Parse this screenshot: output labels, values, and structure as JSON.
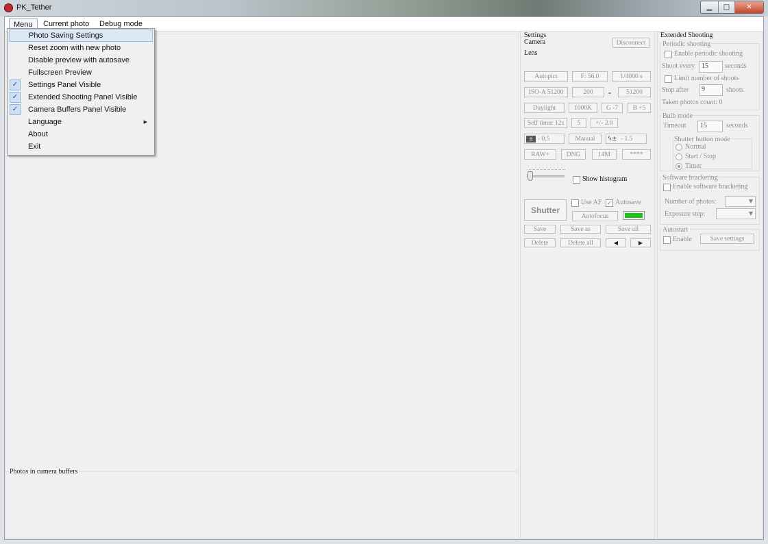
{
  "window": {
    "title": "PK_Tether"
  },
  "menubar": {
    "menu": "Menu",
    "current_photo": "Current photo",
    "debug_mode": "Debug mode"
  },
  "dropdown": {
    "items": [
      {
        "label": "Photo Saving Settings",
        "checked": false,
        "highlighted": true
      },
      {
        "label": "Reset zoom with new photo",
        "checked": false
      },
      {
        "label": "Disable preview with autosave",
        "checked": false
      },
      {
        "label": "Fullscreen Preview",
        "checked": false
      },
      {
        "label": "Settings Panel Visible",
        "checked": true
      },
      {
        "label": "Extended Shooting Panel Visible",
        "checked": true
      },
      {
        "label": "Camera Buffers Panel Visible",
        "checked": true
      },
      {
        "label": "Language",
        "has_submenu": true
      },
      {
        "label": "About"
      },
      {
        "label": "Exit"
      }
    ]
  },
  "buffers": {
    "title": "Photos in camera buffers"
  },
  "settings": {
    "title": "Settings",
    "camera_label": "Camera",
    "lens_label": "Lens",
    "disconnect": "Disconnect",
    "mode": "Autopict",
    "aperture": "F: 56.0",
    "shutter_speed": "1/4000 s",
    "iso_auto": "ISO-A 51200",
    "iso_min": "200",
    "iso_dash": "-",
    "iso_max": "51200",
    "wb": "Daylight",
    "wb_kelvin": "1000K",
    "wb_g": "G -7",
    "wb_b": "B +5",
    "self_timer": "Self timer 12s",
    "timer_count": "5",
    "exp_comp_range": "+/- 2.0",
    "exp_comp": "- 0,5",
    "flash_mode": "Manual",
    "flash_comp": "- 1.5",
    "format": "RAW+",
    "raw_format": "DNG",
    "resolution": "14M",
    "quality": "****",
    "show_histogram": "Show histogram",
    "shutter": "Shutter",
    "use_af": "Use AF",
    "autosave": "Autosave",
    "autofocus": "Autofocus",
    "save": "Save",
    "save_as": "Save as",
    "save_all": "Save all",
    "delete": "Delete",
    "delete_all": "Delete all",
    "prev": "◀",
    "next": "▶",
    "status_color": "#1fbf1f"
  },
  "extended": {
    "title": "Extended Shooting",
    "periodic": {
      "title": "Periodic shooting",
      "enable": "Enable periodic shooting",
      "shoot_every": "Shoot every",
      "shoot_every_value": "15",
      "seconds": "seconds",
      "limit": "Limit number of shoots",
      "stop_after": "Stop after",
      "stop_after_value": "9",
      "shoots": "shoots",
      "taken": "Taken photos count: 0"
    },
    "bulb": {
      "title": "Bulb mode",
      "timeout": "Timeout",
      "timeout_value": "15",
      "seconds": "seconds",
      "button_mode": "Shutter button mode",
      "normal": "Normal",
      "start_stop": "Start / Stop",
      "timer": "Timer"
    },
    "bracketing": {
      "title": "Software bracketing",
      "enable": "Enable software bracketing",
      "num_photos": "Number of photos:",
      "exp_step": "Exposure step:"
    },
    "autostart": {
      "title": "Autostart",
      "enable": "Enable",
      "save_settings": "Save settings"
    }
  }
}
